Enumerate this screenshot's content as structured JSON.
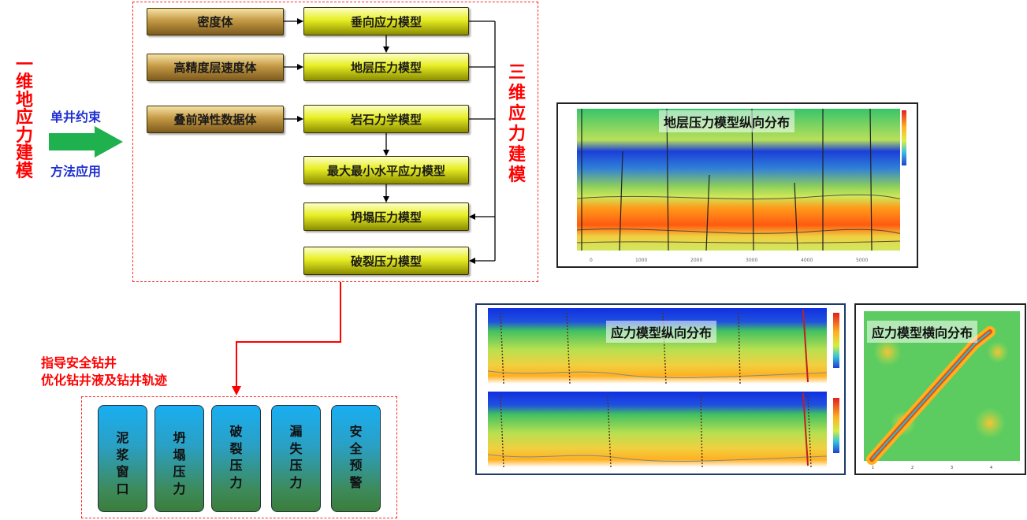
{
  "left_title": [
    "一",
    "维",
    "地",
    "应",
    "力",
    "建",
    "模"
  ],
  "arrow_top_label": "单井约束",
  "arrow_bottom_label": "方法应用",
  "inputs": [
    "密度体",
    "高精度层速度体",
    "叠前弹性数据体"
  ],
  "models": [
    "垂向应力模型",
    "地层压力模型",
    "岩石力学模型",
    "最大最小水平应力模型",
    "坍塌压力模型",
    "破裂压力模型"
  ],
  "right_title": [
    "三",
    "维",
    "应",
    "力",
    "建",
    "模"
  ],
  "guidance": [
    "指导安全钻井",
    "优化钻井液及钻井轨迹"
  ],
  "applications": [
    [
      "泥",
      "浆",
      "窗",
      "口"
    ],
    [
      "坍",
      "塌",
      "压",
      "力"
    ],
    [
      "破",
      "裂",
      "压",
      "力"
    ],
    [
      "漏",
      "失",
      "压",
      "力"
    ],
    [
      "安",
      "全",
      "预",
      "警"
    ]
  ],
  "plot_captions": {
    "pressure": "地层压力模型纵向分布",
    "stress_vertical": "应力模型纵向分布",
    "stress_horizontal": "应力模型横向分布"
  },
  "colors": {
    "accent_red": "#ff0000",
    "label_blue": "#1f2fd0",
    "arrow_green": "#1fb14d"
  }
}
